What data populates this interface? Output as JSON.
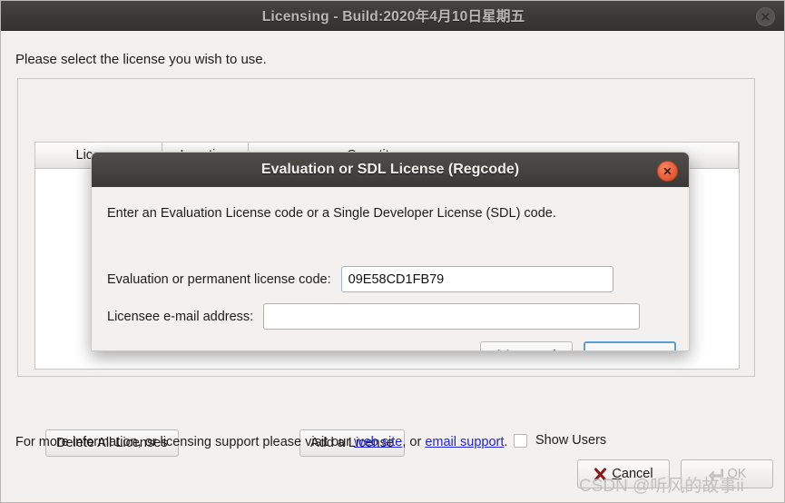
{
  "window": {
    "title": "Licensing - Build:2020年4月10日星期五",
    "close_icon": "close-icon",
    "instruction": "Please select the license you wish to use."
  },
  "table": {
    "columns": [
      {
        "label": "License",
        "sort_indicator": "chevron-down-icon"
      },
      {
        "label": "Location"
      },
      {
        "label": "Quantity"
      }
    ],
    "rows": []
  },
  "actions": {
    "delete_all_label": "Delete All Licenses",
    "add_license_label": "Add a License",
    "show_users_label": "Show Users",
    "show_users_checked": false
  },
  "footer": {
    "prefix": "For more information, or licensing support please visit our ",
    "link_web_site": "web site",
    "middle": ", or ",
    "link_email_support": "email support",
    "suffix": "."
  },
  "window_buttons": {
    "cancel_mnemonic": "C",
    "cancel_rest": "ancel",
    "ok_mnemonic": "O",
    "ok_rest": "K",
    "cancel_icon": "x-mark-icon",
    "ok_icon": "enter-arrow-icon",
    "ok_disabled": true
  },
  "modal": {
    "title": "Evaluation or SDL License (Regcode)",
    "close_icon": "close-icon",
    "description": "Enter an Evaluation License code or a Single Developer License (SDL) code.",
    "code_field": {
      "label": "Evaluation or permanent license code:",
      "value": "09E58CD1FB79",
      "placeholder": ""
    },
    "email_field": {
      "label": "Licensee e-mail address:",
      "value": "",
      "placeholder": ""
    },
    "cancel_mnemonic": "C",
    "cancel_rest": "ancel",
    "ok_mnemonic": "O",
    "ok_rest": "K",
    "cancel_icon": "x-mark-icon",
    "ok_icon": "enter-arrow-icon"
  },
  "watermark": {
    "text": "CSDN @听风的故事ii"
  },
  "colors": {
    "titlebar": "#3c3a38",
    "modal_close": "#e8603c",
    "link": "#2222dd",
    "focus_ring": "#5a9fd4",
    "cancel_icon": "#8b1a1a",
    "ok_icon": "#6f8f4a"
  }
}
